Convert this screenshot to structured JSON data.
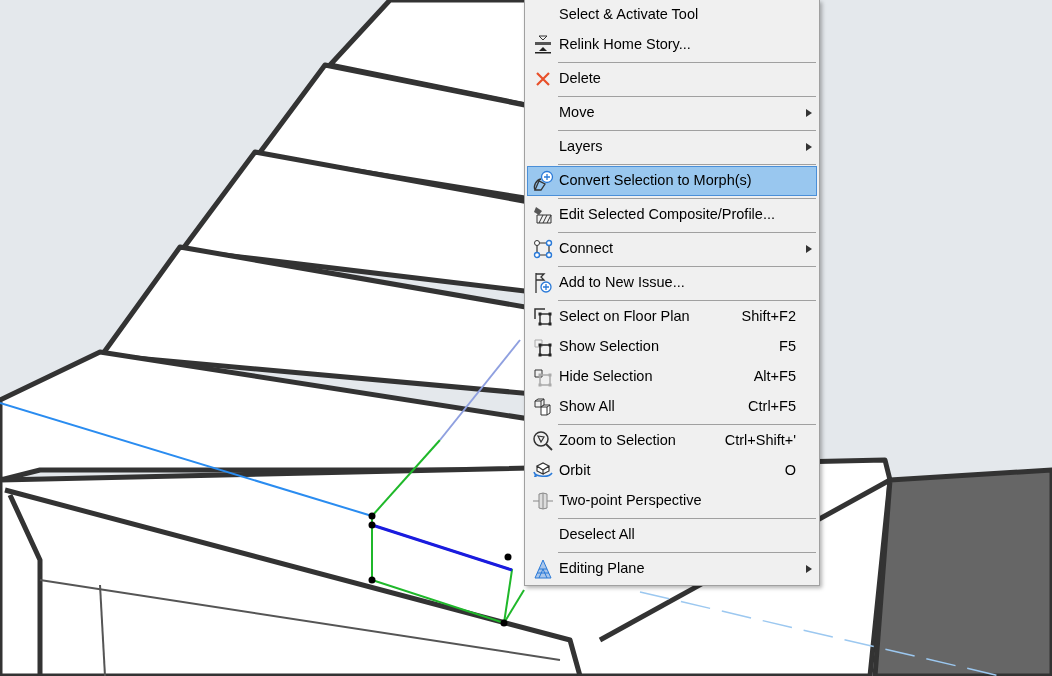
{
  "context_menu": {
    "items": [
      {
        "kind": "item",
        "label": "Select & Activate Tool",
        "selected": false,
        "submenu": false
      },
      {
        "kind": "item",
        "label": "Relink Home Story...",
        "selected": false,
        "submenu": false
      },
      {
        "kind": "separator"
      },
      {
        "kind": "item",
        "label": "Delete",
        "selected": false,
        "submenu": false
      },
      {
        "kind": "separator"
      },
      {
        "kind": "item",
        "label": "Move",
        "selected": false,
        "submenu": true
      },
      {
        "kind": "separator"
      },
      {
        "kind": "item",
        "label": "Layers",
        "selected": false,
        "submenu": true
      },
      {
        "kind": "separator"
      },
      {
        "kind": "item",
        "label": "Convert Selection to Morph(s)",
        "selected": true,
        "submenu": false
      },
      {
        "kind": "separator"
      },
      {
        "kind": "item",
        "label": "Edit Selected Composite/Profile...",
        "selected": false,
        "submenu": false
      },
      {
        "kind": "separator"
      },
      {
        "kind": "item",
        "label": "Connect",
        "selected": false,
        "submenu": true
      },
      {
        "kind": "separator"
      },
      {
        "kind": "item",
        "label": "Add to New Issue...",
        "selected": false,
        "submenu": false
      },
      {
        "kind": "separator"
      },
      {
        "kind": "item",
        "label": "Select on Floor Plan",
        "shortcut": "Shift+F2",
        "selected": false,
        "submenu": false
      },
      {
        "kind": "item",
        "label": "Show Selection",
        "shortcut": "F5",
        "selected": false,
        "submenu": false
      },
      {
        "kind": "item",
        "label": "Hide Selection",
        "shortcut": "Alt+F5",
        "selected": false,
        "submenu": false
      },
      {
        "kind": "item",
        "label": "Show All",
        "shortcut": "Ctrl+F5",
        "selected": false,
        "submenu": false
      },
      {
        "kind": "separator"
      },
      {
        "kind": "item",
        "label": "Zoom to Selection",
        "shortcut": "Ctrl+Shift+'",
        "selected": false,
        "submenu": false
      },
      {
        "kind": "item",
        "label": "Orbit",
        "shortcut": "O",
        "selected": false,
        "submenu": false
      },
      {
        "kind": "item",
        "label": "Two-point Perspective",
        "selected": false,
        "submenu": false
      },
      {
        "kind": "separator"
      },
      {
        "kind": "item",
        "label": "Deselect All",
        "selected": false,
        "submenu": false
      },
      {
        "kind": "separator"
      },
      {
        "kind": "item",
        "label": "Editing Plane",
        "selected": false,
        "submenu": true
      }
    ]
  }
}
